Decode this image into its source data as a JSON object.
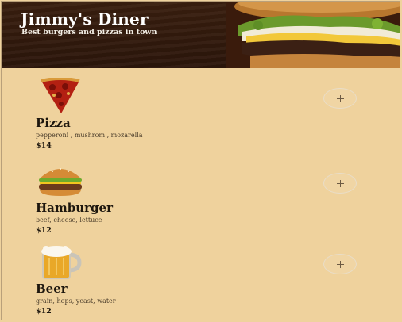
{
  "header": {
    "title": "Jimmy's Diner",
    "subtitle": "Best burgers and pizzas in town"
  },
  "menu": {
    "items": [
      {
        "name": "Pizza",
        "description": "pepperoni , mushrom , mozarella",
        "price": "$14",
        "icon": "pizza-icon"
      },
      {
        "name": "Hamburger",
        "description": "beef, cheese, lettuce",
        "price": "$12",
        "icon": "hamburger-icon"
      },
      {
        "name": "Beer",
        "description": "grain, hops, yeast, water",
        "price": "$12",
        "icon": "beer-icon"
      }
    ]
  },
  "colors": {
    "background": "#efd29d",
    "header_bg": "#2c160b",
    "text": "#1e170e"
  }
}
